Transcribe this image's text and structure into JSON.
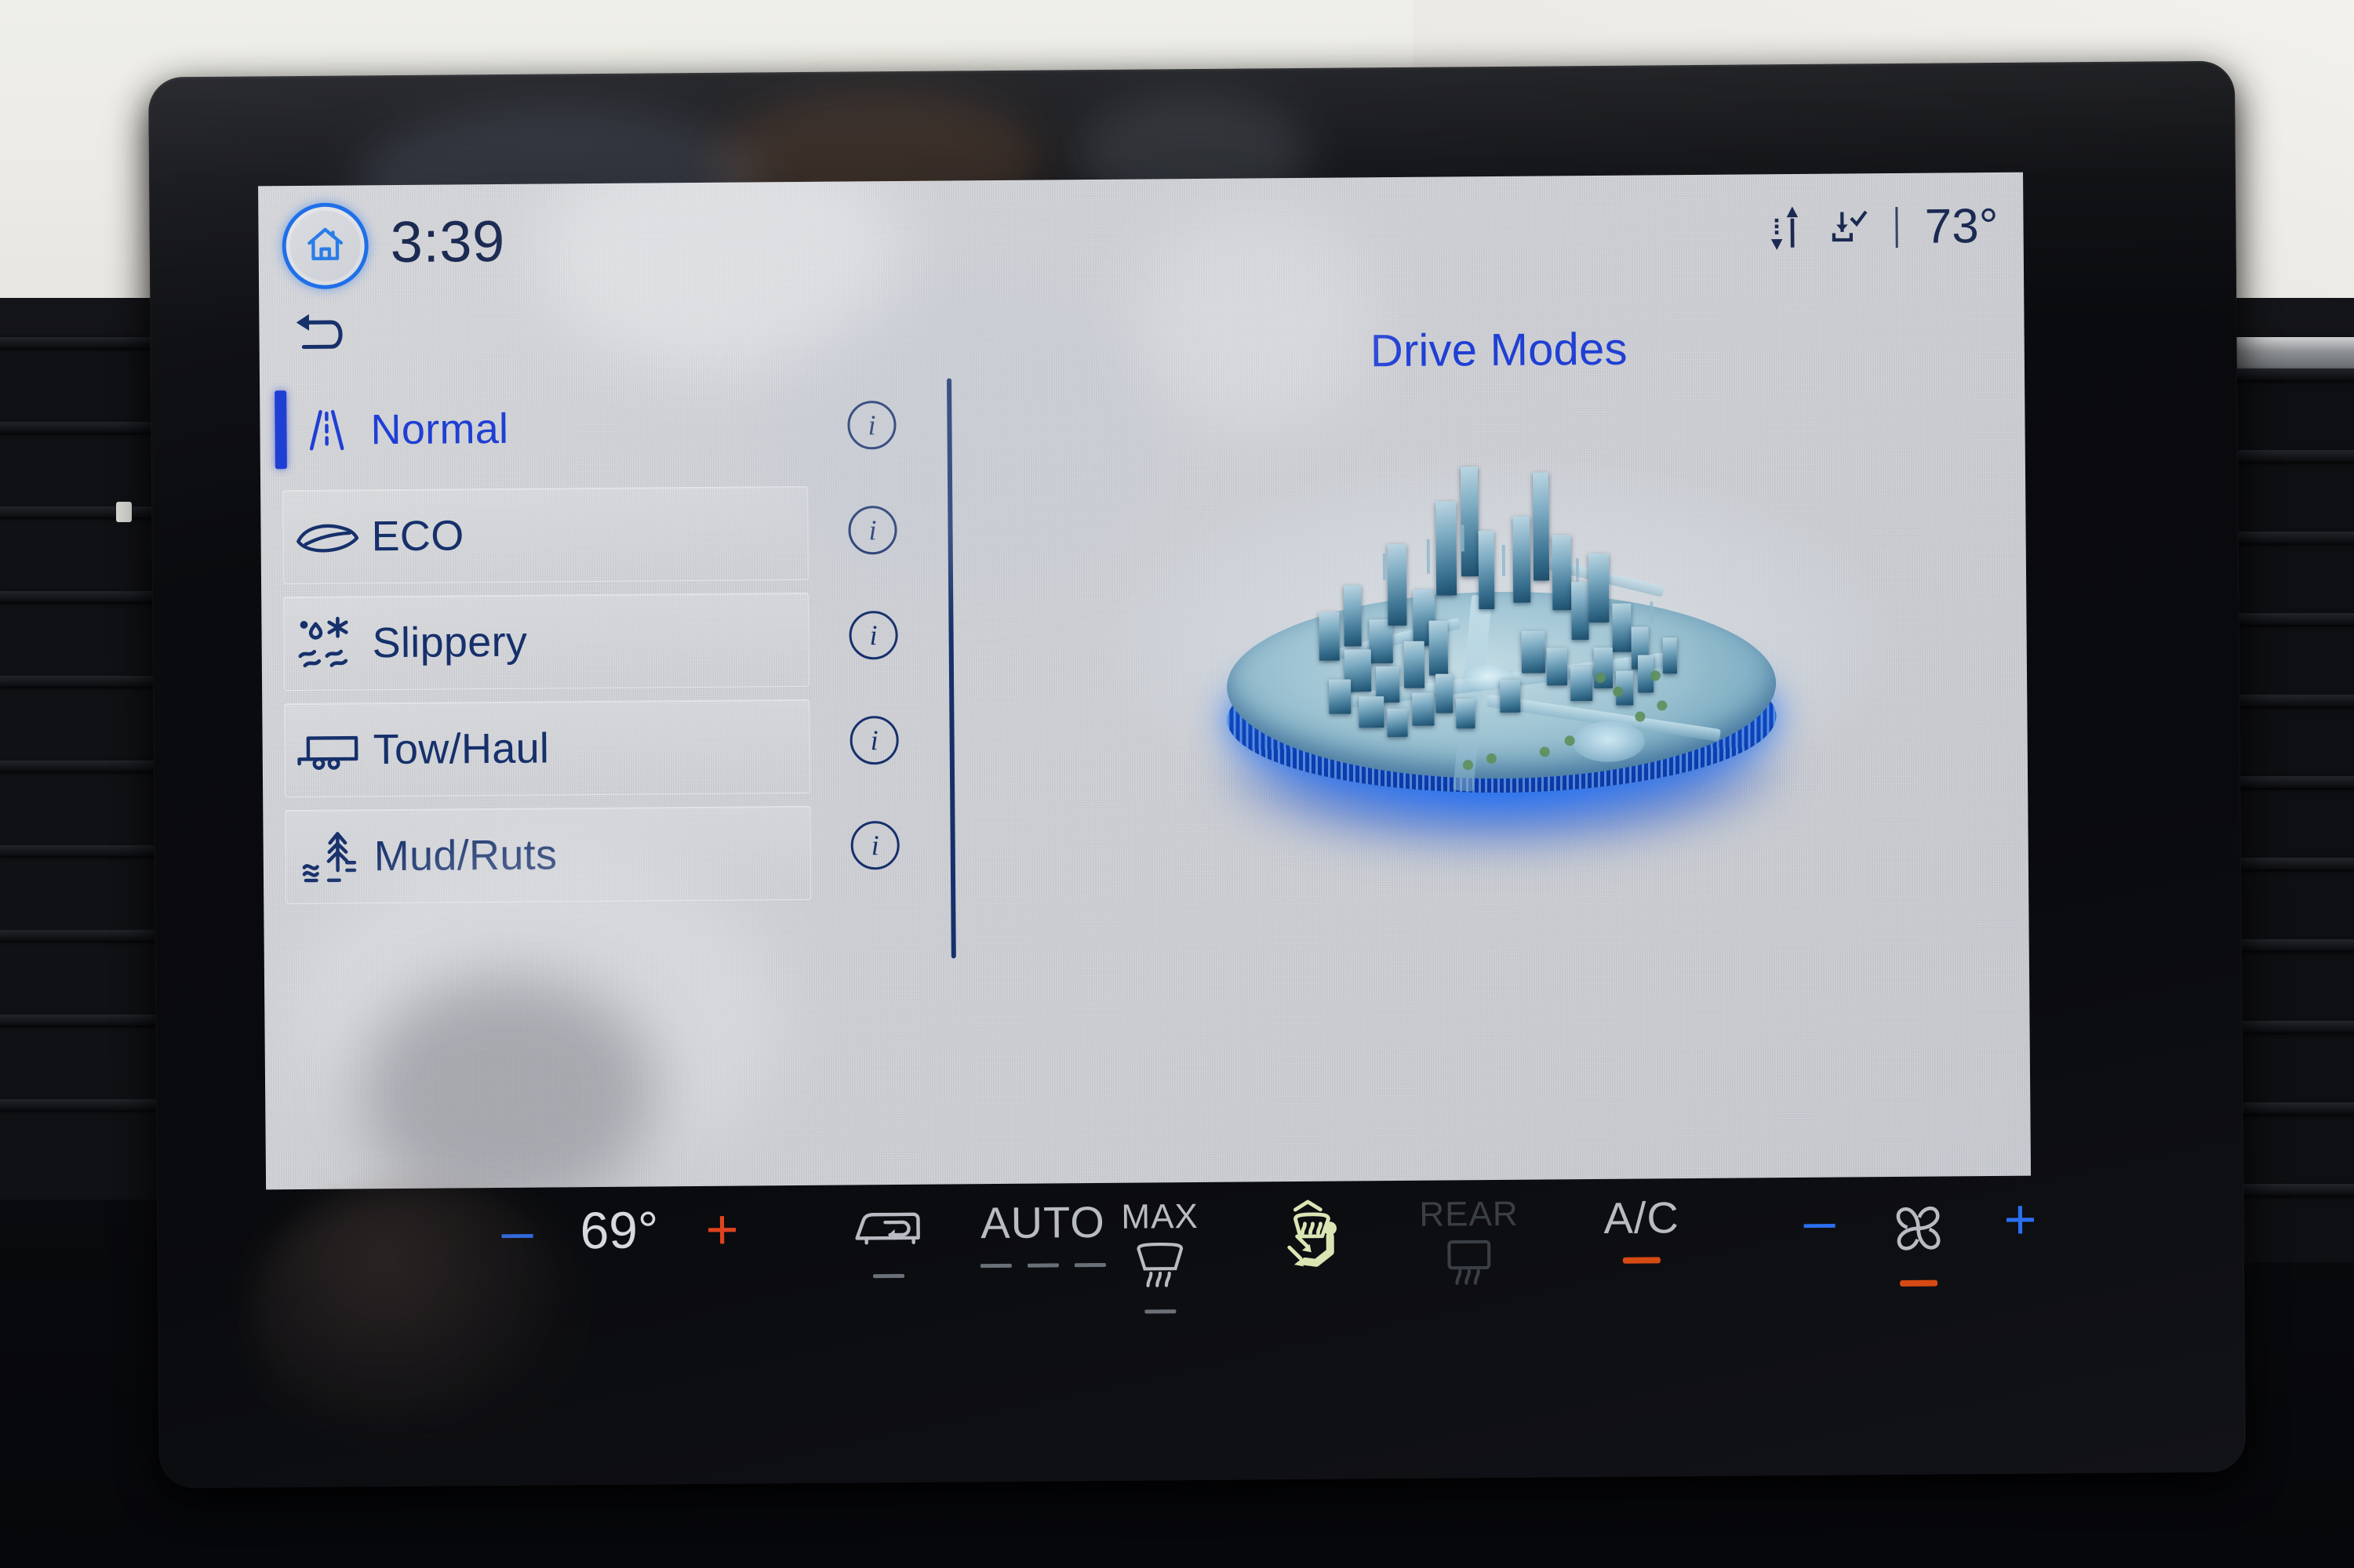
{
  "status_bar": {
    "home_icon": "home-icon",
    "clock": "3:39",
    "data_transfer_icon": "data-transfer-icon",
    "download_complete_icon": "download-complete-icon",
    "outside_temperature": "73°"
  },
  "navigation": {
    "back_icon": "back-arrow-icon"
  },
  "screen": {
    "title": "Drive Modes",
    "graphic": "city-diorama-3d"
  },
  "drive_modes": [
    {
      "label": "Normal",
      "icon": "road-lane-icon",
      "selected": true,
      "info_label": "i"
    },
    {
      "label": "ECO",
      "icon": "leaf-icon",
      "selected": false,
      "info_label": "i"
    },
    {
      "label": "Slippery",
      "icon": "snowflake-skid-icon",
      "selected": false,
      "info_label": "i"
    },
    {
      "label": "Tow/Haul",
      "icon": "trailer-icon",
      "selected": false,
      "info_label": "i"
    },
    {
      "label": "Mud/Ruts",
      "icon": "tree-water-icon",
      "selected": false,
      "info_label": "i"
    }
  ],
  "climate_bar": {
    "temp_decrease": "–",
    "driver_temperature": "69°",
    "temp_increase": "+",
    "recirculation_icon": "air-recirculation-icon",
    "auto_label": "AUTO",
    "max_label": "MAX",
    "front_defrost_icon": "front-defrost-icon",
    "airflow_icon": "seat-airflow-icon",
    "rear_label": "REAR",
    "rear_defrost_icon": "rear-defrost-icon",
    "ac_label": "A/C",
    "fan_decrease": "–",
    "fan_icon": "fan-icon",
    "fan_increase": "+"
  },
  "colors": {
    "accent_blue": "#1f3fd4",
    "nav_blue": "#16306b",
    "home_ring": "#1f6fe8",
    "display_bg": "#d2d4d9",
    "climate_text": "#b8bcc2",
    "indicator_orange": "#d64a14",
    "minus_blue": "#2b6ef0",
    "plus_red": "#e0431f"
  }
}
